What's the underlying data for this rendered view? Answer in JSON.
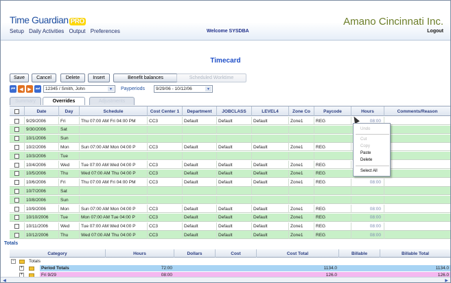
{
  "app": {
    "logo_main": "Time Guardian",
    "logo_pro": "PRO",
    "brand": "Amano Cincinnati Inc.",
    "menu": [
      "Setup",
      "Daily Activities",
      "Output",
      "Preferences"
    ],
    "welcome": "Welcome SYSDBA",
    "logout": "Logout"
  },
  "page": {
    "title": "Timecard"
  },
  "toolbar": {
    "save": "Save",
    "cancel": "Cancel",
    "delete": "Delete",
    "insert": "Insert",
    "benefit": "Benefit balances",
    "disabled_btn": "Scheduled Worktime"
  },
  "nav": {
    "employee": "12345 / Smith, John",
    "payperiods_label": "Payperiods",
    "payperiod": "9/29/06 - 10/12/06"
  },
  "tabs": [
    "Summary",
    "Overrides",
    "Adjustments"
  ],
  "grid": {
    "headers": [
      "",
      "Date",
      "Day",
      "Schedule",
      "Cost Center 1",
      "Department",
      "JOBCLASS",
      "LEVEL4",
      "Zone Co",
      "Paycode",
      "Hours",
      "Comments/Reason"
    ],
    "rows": [
      {
        "date": "9/29/2006",
        "day": "Fri",
        "schedule": "Thu 07:00 AM Fri 04:00 PM",
        "cc": "CC3",
        "dept": "Default",
        "job": "Default",
        "l4": "Default",
        "zone": "Zone1",
        "pay": "REG",
        "hours": "08:00",
        "color": "white"
      },
      {
        "date": "9/30/2006",
        "day": "Sat",
        "schedule": "",
        "cc": "",
        "dept": "",
        "job": "",
        "l4": "",
        "zone": "",
        "pay": "",
        "hours": "",
        "color": "green"
      },
      {
        "date": "10/1/2006",
        "day": "Sun",
        "schedule": "",
        "cc": "",
        "dept": "",
        "job": "",
        "l4": "",
        "zone": "",
        "pay": "",
        "hours": "",
        "color": "green"
      },
      {
        "date": "10/2/2006",
        "day": "Mon",
        "schedule": "Sun 07:00 AM Mon 04:00 P",
        "cc": "CC3",
        "dept": "Default",
        "job": "Default",
        "l4": "Default",
        "zone": "Zone1",
        "pay": "REG",
        "hours": "",
        "color": "white"
      },
      {
        "date": "10/3/2006",
        "day": "Tue",
        "schedule": "",
        "cc": "",
        "dept": "",
        "job": "",
        "l4": "",
        "zone": "",
        "pay": "",
        "hours": "",
        "color": "green"
      },
      {
        "date": "10/4/2006",
        "day": "Wed",
        "schedule": "Tue 07:00 AM Wed 04:00 P",
        "cc": "CC3",
        "dept": "Default",
        "job": "Default",
        "l4": "Default",
        "zone": "Zone1",
        "pay": "REG",
        "hours": "",
        "color": "white"
      },
      {
        "date": "10/5/2006",
        "day": "Thu",
        "schedule": "Wed 07:00 AM Thu 04:00 P",
        "cc": "CC3",
        "dept": "Default",
        "job": "Default",
        "l4": "Default",
        "zone": "Zone1",
        "pay": "REG",
        "hours": "",
        "color": "green"
      },
      {
        "date": "10/6/2006",
        "day": "Fri",
        "schedule": "Thu 07:00 AM Fri 04:00 PM",
        "cc": "CC3",
        "dept": "Default",
        "job": "Default",
        "l4": "Default",
        "zone": "Zone1",
        "pay": "REG",
        "hours": "08:00",
        "color": "white"
      },
      {
        "date": "10/7/2006",
        "day": "Sat",
        "schedule": "",
        "cc": "",
        "dept": "",
        "job": "",
        "l4": "",
        "zone": "",
        "pay": "",
        "hours": "",
        "color": "green"
      },
      {
        "date": "10/8/2006",
        "day": "Sun",
        "schedule": "",
        "cc": "",
        "dept": "",
        "job": "",
        "l4": "",
        "zone": "",
        "pay": "",
        "hours": "",
        "color": "green"
      },
      {
        "date": "10/9/2006",
        "day": "Mon",
        "schedule": "Sun 07:00 AM Mon 04:00 P",
        "cc": "CC3",
        "dept": "Default",
        "job": "Default",
        "l4": "Default",
        "zone": "Zone1",
        "pay": "REG",
        "hours": "08:00",
        "color": "white"
      },
      {
        "date": "10/10/2006",
        "day": "Tue",
        "schedule": "Mon 07:00 AM Tue 04:00 P",
        "cc": "CC3",
        "dept": "Default",
        "job": "Default",
        "l4": "Default",
        "zone": "Zone1",
        "pay": "REG",
        "hours": "08:00",
        "color": "green"
      },
      {
        "date": "10/11/2006",
        "day": "Wed",
        "schedule": "Tue 07:00 AM Wed 04:00 P",
        "cc": "CC3",
        "dept": "Default",
        "job": "Default",
        "l4": "Default",
        "zone": "Zone1",
        "pay": "REG",
        "hours": "08:00",
        "color": "white"
      },
      {
        "date": "10/12/2006",
        "day": "Thu",
        "schedule": "Wed 07:00 AM Thu 04:00 P",
        "cc": "CC3",
        "dept": "Default",
        "job": "Default",
        "l4": "Default",
        "zone": "Zone1",
        "pay": "REG",
        "hours": "08:00",
        "color": "green"
      }
    ]
  },
  "context_menu": [
    "Undo",
    "Cut",
    "Copy",
    "Paste",
    "Delete",
    "Select All"
  ],
  "totals": {
    "label": "Totals",
    "headers": [
      "Category",
      "Hours",
      "Dollars",
      "Cost",
      "Cost Total",
      "Billable",
      "Billable Total"
    ],
    "root": "Totals",
    "rows": [
      {
        "cat": "Period Totals",
        "hours": "72:00",
        "dollars": "",
        "cost": "",
        "cost_total": "1134.0",
        "billable": "",
        "billable_total": "1134.0",
        "color": "#a8d4f4",
        "bold": true
      },
      {
        "cat": "Fri 9/29",
        "hours": "08:00",
        "dollars": "",
        "cost": "",
        "cost_total": "126.0",
        "billable": "",
        "billable_total": "126.0",
        "color": "#f4b8f0",
        "bold": false
      }
    ]
  },
  "colors": {
    "accent": "#1f4fa0",
    "green_row": "#c8f0c8",
    "brand": "#6b7d28"
  }
}
